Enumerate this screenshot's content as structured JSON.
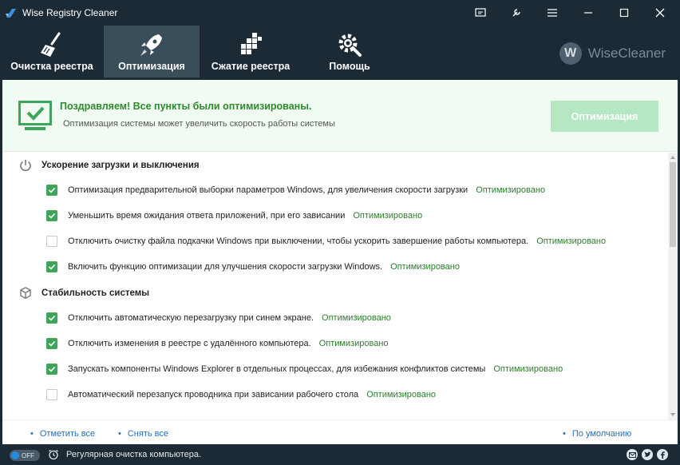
{
  "window": {
    "title": "Wise Registry Cleaner"
  },
  "nav": {
    "tabs": [
      {
        "label": "Очистка реестра",
        "icon": "broom-icon"
      },
      {
        "label": "Оптимизация",
        "icon": "rocket-icon",
        "active": true
      },
      {
        "label": "Сжатие реестра",
        "icon": "defrag-icon"
      },
      {
        "label": "Помощь",
        "icon": "gear-wrench-icon"
      }
    ],
    "brand": {
      "logo_letter": "W",
      "name": "WiseCleaner"
    }
  },
  "banner": {
    "title": "Поздравляем! Все пункты были оптимизированы.",
    "subtitle": "Оптимизация системы может увеличить скорость работы системы",
    "button_label": "Оптимизация"
  },
  "sections": [
    {
      "title": "Ускорение загрузки и выключения",
      "icon": "power-icon",
      "items": [
        {
          "text": "Оптимизация предварительной выборки параметров Windows, для увеличения скорости загрузки",
          "status": "Оптимизировано",
          "checked": true
        },
        {
          "text": "Уменьшить время ожидания ответа приложений, при его зависании",
          "status": "Оптимизировано",
          "checked": true
        },
        {
          "text": "Отключить очистку файла подкачки Windows при выключении, чтобы ускорить завершение работы компьютера.",
          "status": "Оптимизировано",
          "checked": false
        },
        {
          "text": "Включить функцию оптимизации для улучшения скорости загрузки Windows.",
          "status": "Оптимизировано",
          "checked": true
        }
      ]
    },
    {
      "title": "Стабильность системы",
      "icon": "cube-icon",
      "items": [
        {
          "text": "Отключить автоматическую перезагрузку при синем экране.",
          "status": "Оптимизировано",
          "checked": true
        },
        {
          "text": "Отключить изменения в реестре с удалённого компьютера.",
          "status": "Оптимизировано",
          "checked": true
        },
        {
          "text": "Запускать компоненты Windows Explorer в отдельных процессах, для избежания конфликтов системы",
          "status": "Оптимизировано",
          "checked": true
        },
        {
          "text": "Автоматический перезапуск проводника при зависании рабочего стола",
          "status": "Оптимизировано",
          "checked": false
        }
      ]
    }
  ],
  "footer": {
    "select_all": "Отметить все",
    "deselect_all": "Снять все",
    "defaults": "По умолчанию"
  },
  "statusbar": {
    "toggle_label": "OFF",
    "text": "Регулярная очистка компьютера."
  },
  "colors": {
    "accent_green": "#3ea55a",
    "status_green": "#2d7d2d",
    "dark_bg": "#1b2a35",
    "link_blue": "#2a6fb5"
  }
}
